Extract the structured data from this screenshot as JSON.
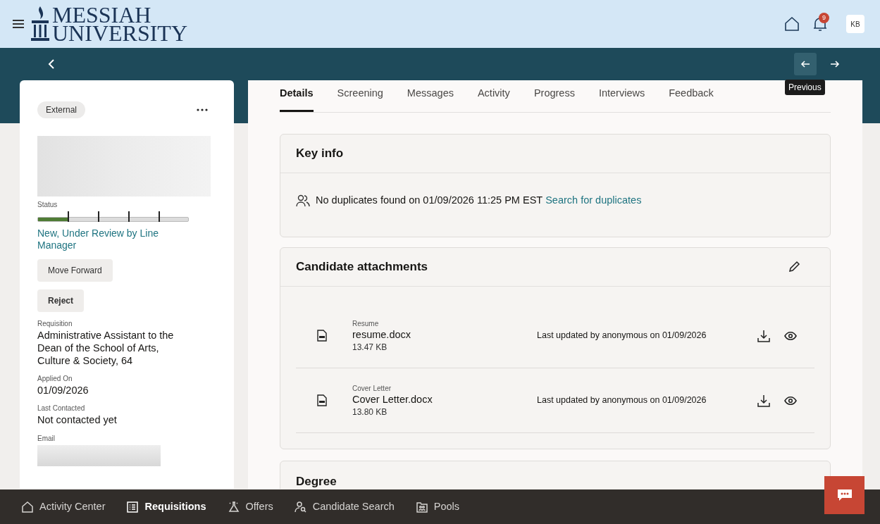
{
  "header": {
    "logo": {
      "line1": "MESSIAH",
      "line2": "UNIVERSITY"
    },
    "notification_count": "9",
    "avatar": "KB"
  },
  "nav_bar": {
    "tooltip": "Previous"
  },
  "candidate": {
    "tag": "External",
    "status": {
      "label": "Status",
      "level": 0.2,
      "text": "New, Under Review by Line Manager"
    },
    "actions": [
      "Move Forward",
      "Reject"
    ],
    "fields": [
      {
        "label": "Requisition",
        "value": "Administrative Assistant to the Dean of the School of Arts, Culture & Society, 64"
      },
      {
        "label": "Applied On",
        "value": "01/09/2026"
      },
      {
        "label": "Last Contacted",
        "value": "Not contacted yet"
      }
    ],
    "email_label": "Email"
  },
  "tabs": [
    {
      "label": "Details",
      "selected": true
    },
    {
      "label": "Screening",
      "selected": false
    },
    {
      "label": "Messages",
      "selected": false
    },
    {
      "label": "Activity",
      "selected": false
    },
    {
      "label": "Progress",
      "selected": false
    },
    {
      "label": "Interviews",
      "selected": false
    },
    {
      "label": "Feedback",
      "selected": false
    }
  ],
  "key_info": {
    "title": "Key info",
    "text": "No duplicates found on 01/09/2026 11:25 PM EST",
    "link": "Search for duplicates"
  },
  "attachments": {
    "title": "Candidate attachments",
    "items": [
      {
        "category": "Resume",
        "filename": "resume.docx",
        "size": "13.47 KB",
        "updated": "Last updated by anonymous on 01/09/2026"
      },
      {
        "category": "Cover Letter",
        "filename": "Cover Letter.docx",
        "size": "13.80 KB",
        "updated": "Last updated by anonymous on 01/09/2026"
      }
    ]
  },
  "degree": {
    "title": "Degree"
  },
  "bottom_nav": [
    {
      "label": "Activity Center",
      "kind": "home",
      "selected": false
    },
    {
      "label": "Requisitions",
      "kind": "list",
      "selected": true
    },
    {
      "label": "Offers",
      "kind": "offer",
      "selected": false
    },
    {
      "label": "Candidate Search",
      "kind": "person-search",
      "selected": false
    },
    {
      "label": "Pools",
      "kind": "pool",
      "selected": false
    }
  ]
}
